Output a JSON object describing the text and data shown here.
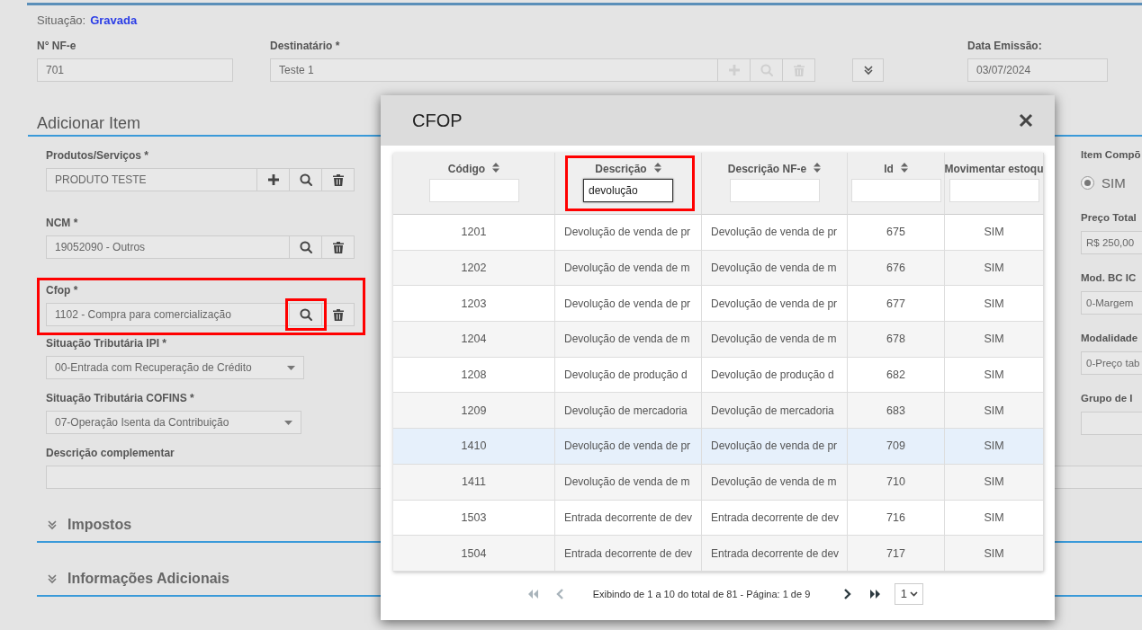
{
  "status": {
    "label": "Situação:",
    "value": "Gravada"
  },
  "header_fields": [
    {
      "kind": "text",
      "label": "N° NF-e",
      "value": "701"
    },
    {
      "kind": "lookup",
      "label": "Destinatário *",
      "value": "Teste 1",
      "disabled": true,
      "actions": [
        {
          "kind": "add"
        },
        {
          "kind": "search"
        },
        {
          "kind": "delete"
        }
      ]
    },
    {
      "kind": "expand",
      "expanded": false
    },
    {
      "kind": "text",
      "label": "Data Emissão:",
      "value": "03/07/2024"
    }
  ],
  "section_title": "Adicionar Item",
  "item_fields": [
    {
      "kind": "lookup",
      "label": "Produtos/Serviços *",
      "value": "PRODUTO TESTE",
      "disabled": false,
      "highlighted": false,
      "actions": [
        {
          "kind": "add",
          "highlighted": false
        },
        {
          "kind": "search",
          "highlighted": false
        },
        {
          "kind": "delete",
          "highlighted": false
        }
      ]
    },
    {
      "kind": "lookup",
      "label": "NCM *",
      "value": "19052090 - Outros",
      "disabled": false,
      "highlighted": false,
      "actions": [
        {
          "kind": "search",
          "highlighted": false
        },
        {
          "kind": "delete",
          "highlighted": false
        }
      ]
    },
    {
      "kind": "lookup",
      "label": "Cfop *",
      "value": "1102 - Compra para comercialização",
      "disabled": false,
      "highlighted": true,
      "actions": [
        {
          "kind": "search",
          "highlighted": true
        },
        {
          "kind": "delete",
          "highlighted": false
        }
      ]
    },
    {
      "kind": "select",
      "label": "Situação Tributária IPI *",
      "value": "00-Entrada com Recuperação de Crédito"
    },
    {
      "kind": "select",
      "label": "Situação Tributária COFINS *",
      "value": "07-Operação Isenta da Contribuição"
    },
    {
      "kind": "textarea",
      "label": "Descrição complementar"
    }
  ],
  "right_fields": [
    {
      "kind": "radio",
      "label": "Item Compõ",
      "option": "SIM",
      "checked": true
    },
    {
      "kind": "text",
      "label": "Preço Total",
      "value": "R$ 250,00"
    },
    {
      "kind": "text",
      "label": "Mod. BC IC",
      "value": "0-Margem"
    },
    {
      "kind": "text",
      "label": "Modalidade",
      "value": "0-Preço tab"
    },
    {
      "kind": "text",
      "label": "Grupo de I"
    }
  ],
  "collapsibles": [
    {
      "title": "Impostos",
      "expanded": false
    },
    {
      "title": "Informações Adicionais",
      "expanded": false
    }
  ],
  "modal": {
    "title": "CFOP",
    "columns": [
      {
        "label": "Código",
        "sortable": true,
        "highlighted": false
      },
      {
        "label": "Descrição",
        "sortable": true,
        "highlighted": true,
        "filter": "devolução",
        "focused": true
      },
      {
        "label": "Descrição NF-e",
        "sortable": true,
        "highlighted": false
      },
      {
        "label": "Id",
        "sortable": true,
        "highlighted": false
      },
      {
        "label": "Movimentar estoqu",
        "sortable": false,
        "highlighted": false
      }
    ],
    "rows": [
      {
        "selected": false,
        "cells": [
          "1201",
          "Devolução de venda de pr",
          "Devolução de venda de pr",
          "675",
          "SIM"
        ]
      },
      {
        "selected": false,
        "cells": [
          "1202",
          "Devolução de venda de m",
          "Devolução de venda de m",
          "676",
          "SIM"
        ]
      },
      {
        "selected": false,
        "cells": [
          "1203",
          "Devolução de venda de pr",
          "Devolução de venda de pr",
          "677",
          "SIM"
        ]
      },
      {
        "selected": false,
        "cells": [
          "1204",
          "Devolução de venda de m",
          "Devolução de venda de m",
          "678",
          "SIM"
        ]
      },
      {
        "selected": false,
        "cells": [
          "1208",
          "Devolução de produção d",
          "Devolução de produção d",
          "682",
          "SIM"
        ]
      },
      {
        "selected": false,
        "cells": [
          "1209",
          "Devolução de mercadoria",
          "Devolução de mercadoria",
          "683",
          "SIM"
        ]
      },
      {
        "selected": true,
        "cells": [
          "1410",
          "Devolução de venda de pr",
          "Devolução de venda de pr",
          "709",
          "SIM"
        ]
      },
      {
        "selected": false,
        "cells": [
          "1411",
          "Devolução de venda de m",
          "Devolução de venda de m",
          "710",
          "SIM"
        ]
      },
      {
        "selected": false,
        "cells": [
          "1503",
          "Entrada decorrente de dev",
          "Entrada decorrente de dev",
          "716",
          "SIM"
        ]
      },
      {
        "selected": false,
        "cells": [
          "1504",
          "Entrada decorrente de dev",
          "Entrada decorrente de dev",
          "717",
          "SIM"
        ]
      }
    ],
    "pager": {
      "nav_before": [
        {
          "kind": "first",
          "disabled": true
        },
        {
          "kind": "prev",
          "disabled": true
        }
      ],
      "text": "Exibindo de 1 a 10 do total de 81 - Página: 1 de 9",
      "nav_after": [
        {
          "kind": "next",
          "disabled": false
        },
        {
          "kind": "last",
          "disabled": false
        }
      ],
      "page": "1"
    }
  }
}
